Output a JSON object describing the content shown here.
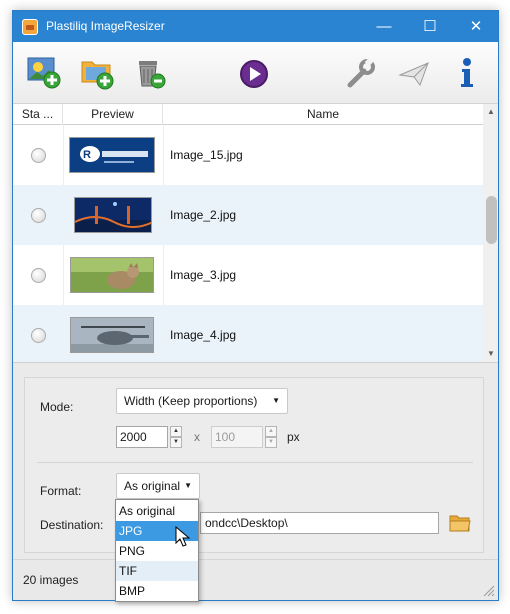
{
  "window": {
    "title": "Plastiliq ImageResizer"
  },
  "title_buttons": {
    "minimize": "—",
    "maximize": "☐",
    "close": "✕"
  },
  "toolbar": {
    "buttons": [
      {
        "icon": "add-image-icon"
      },
      {
        "icon": "add-folder-icon"
      },
      {
        "icon": "remove-icon"
      },
      {
        "icon": "play-icon"
      },
      {
        "icon": "settings-wrench-icon"
      },
      {
        "icon": "send-icon"
      },
      {
        "icon": "info-icon"
      }
    ]
  },
  "grid": {
    "columns": [
      "Sta ...",
      "Preview",
      "Name"
    ],
    "rows": [
      {
        "name": "Image_15.jpg",
        "thumb": "raymond-logo"
      },
      {
        "name": "Image_2.jpg",
        "thumb": "bridge-night"
      },
      {
        "name": "Image_3.jpg",
        "thumb": "cat-grass"
      },
      {
        "name": "Image_4.jpg",
        "thumb": "helicopter"
      }
    ]
  },
  "settings": {
    "mode_label": "Mode:",
    "mode_value": "Width (Keep proportions)",
    "width_value": "2000",
    "x_label": "x",
    "height_value": "100",
    "unit_label": "px",
    "format_label": "Format:",
    "format_value": "As original",
    "destination_label": "Destination:",
    "destination_value": "ondcc\\Desktop\\"
  },
  "format_options": [
    "As original",
    "JPG",
    "PNG",
    "TIF",
    "BMP"
  ],
  "format_highlighted": "JPG",
  "status": {
    "text": "20 images"
  },
  "colors": {
    "titlebar": "#2b84d2",
    "selection": "#3c9ae2",
    "row_alt": "#eaf3f9"
  }
}
